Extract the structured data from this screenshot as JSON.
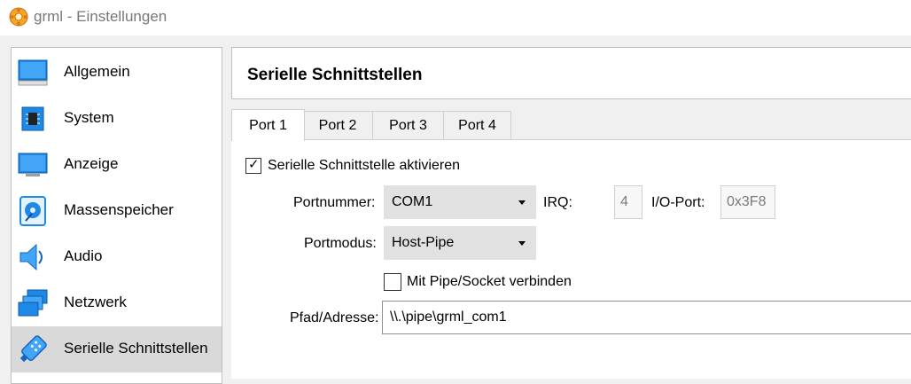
{
  "window": {
    "title": "grml - Einstellungen",
    "icon": "virtualbox-gear-icon"
  },
  "sidebar": {
    "items": [
      {
        "label": "Allgemein",
        "icon": "monitor-general-icon"
      },
      {
        "label": "System",
        "icon": "chip-icon"
      },
      {
        "label": "Anzeige",
        "icon": "display-icon"
      },
      {
        "label": "Massenspeicher",
        "icon": "disk-icon"
      },
      {
        "label": "Audio",
        "icon": "speaker-icon"
      },
      {
        "label": "Netzwerk",
        "icon": "network-icon"
      },
      {
        "label": "Serielle Schnittstellen",
        "icon": "serial-port-icon",
        "selected": true
      }
    ]
  },
  "page": {
    "title": "Serielle Schnittstellen"
  },
  "tabs": [
    {
      "label": "Port 1",
      "active": true
    },
    {
      "label": "Port 2"
    },
    {
      "label": "Port 3"
    },
    {
      "label": "Port 4"
    }
  ],
  "form": {
    "enable_label": "Serielle Schnittstelle aktivieren",
    "enable_checked": true,
    "port_number_label": "Portnummer:",
    "port_number_value": "COM1",
    "irq_label": "IRQ:",
    "irq_value": "4",
    "io_port_label": "I/O-Port:",
    "io_port_value": "0x3F8",
    "port_mode_label": "Portmodus:",
    "port_mode_value": "Host-Pipe",
    "connect_label": "Mit Pipe/Socket verbinden",
    "connect_checked": false,
    "path_label": "Pfad/Adresse:",
    "path_value": "\\\\.\\pipe\\grml_com1"
  },
  "colors": {
    "selected_item_bg": "#d9d9d9",
    "icon_blue": "#1e90e0"
  }
}
